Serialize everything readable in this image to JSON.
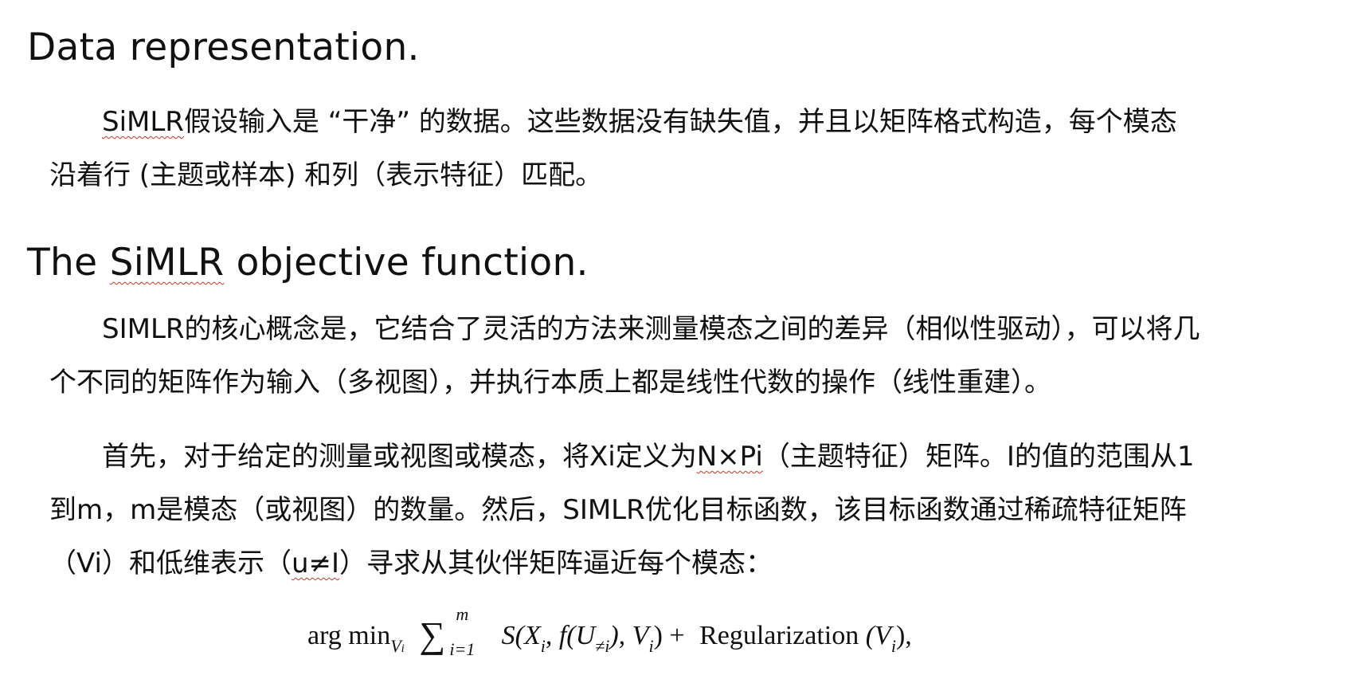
{
  "section1": {
    "heading": "Data representation.",
    "para": [
      [
        "",
        "SiMLR",
        "假设输入是 “干净” 的数据。这些数据没有缺失值，并且以矩阵格式构造，每个模态"
      ],
      [
        "沿着行 (主题或样本) 和列（表示特征）匹配。"
      ]
    ]
  },
  "section2": {
    "heading_pre": "The ",
    "heading_term": "SiMLR",
    "heading_post": " objective function.",
    "para1": [
      "SIMLR的核心概念是，它结合了灵活的方法来测量模态之间的差异（相似性驱动），可以将几",
      "个不同的矩阵作为输入（多视图），并执行本质上都是线性代数的操作（线性重建）。"
    ],
    "para2": {
      "line1_a": "首先，对于给定的测量或视图或模态，将Xi定义为",
      "line1_term": "N×Pi",
      "line1_b": "（主题特征）矩阵。I的值的范围从1",
      "line2": "到m，m是模态（或视图）的数量。然后，SIMLR优化目标函数，该目标函数通过稀疏特征矩阵",
      "line3_a": "（Vi）和低维表示（",
      "line3_term": "u≠I",
      "line3_b": "）寻求从其伙伴矩阵逼近每个模态："
    }
  },
  "equation": {
    "op": "arg min",
    "op_sub": "V",
    "op_sub_index": "i",
    "sum_upper": "m",
    "sum_lower": "i=1",
    "body": "S(X",
    "body_sub1": "i",
    "body_mid": ", f(U",
    "body_sub2": "≠i",
    "body_mid2": "), V",
    "body_sub3": "i",
    "body_end": ") +",
    "reg_label": "Regularization",
    "reg_arg": "(V",
    "reg_sub": "i",
    "reg_end": "),"
  }
}
